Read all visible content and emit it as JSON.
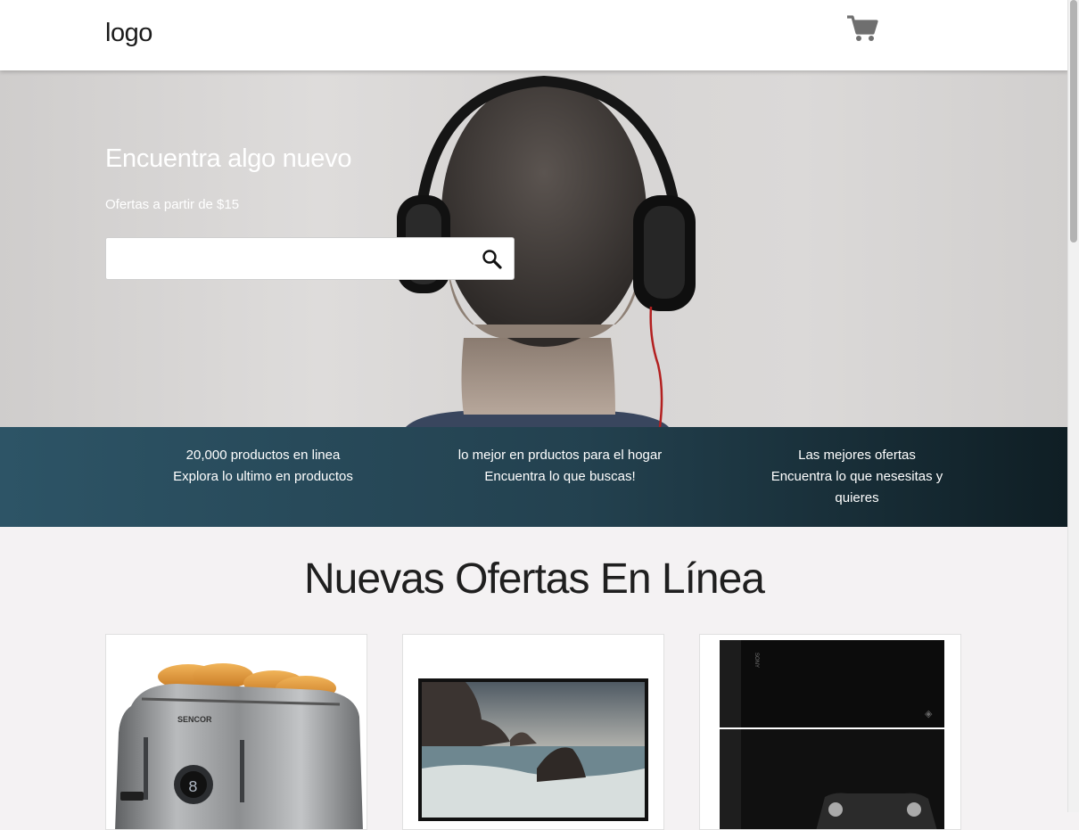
{
  "header": {
    "logo": "logo",
    "cart_icon": "shopping-cart-icon"
  },
  "hero": {
    "title": "Encuentra algo nuevo",
    "subtitle": "Ofertas a partir de $15",
    "search": {
      "placeholder": "",
      "value": "",
      "icon": "search-icon"
    }
  },
  "features": [
    {
      "line1": "20,000 productos en linea",
      "line2": "Explora lo ultimo en productos"
    },
    {
      "line1": "lo mejor en prductos para el hogar",
      "line2": "Encuentra lo que buscas!"
    },
    {
      "line1": "Las mejores ofertas",
      "line2": "Encuentra lo que nesesitas y quieres"
    }
  ],
  "offers": {
    "title": "Nuevas Ofertas En Línea",
    "products": [
      {
        "image": "toaster-image",
        "brand": "SENCOR",
        "display": "8"
      },
      {
        "image": "television-image"
      },
      {
        "image": "game-console-image",
        "brand": "SONY"
      }
    ]
  },
  "colors": {
    "band_start": "#2d5466",
    "band_end": "#0f1e24",
    "page_bg": "#f4f2f3"
  }
}
